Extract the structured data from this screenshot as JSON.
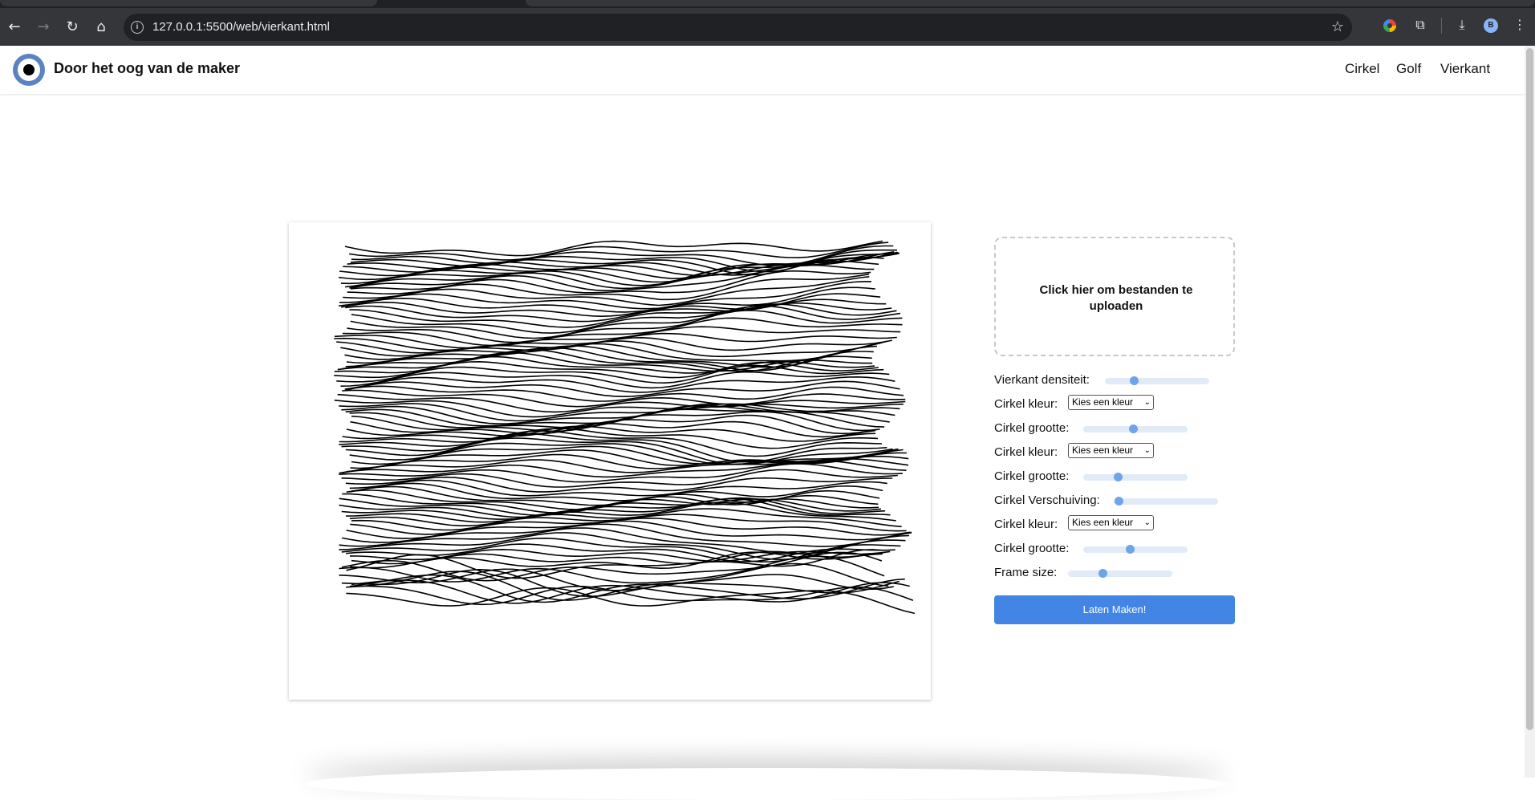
{
  "browser": {
    "url": "127.0.0.1:5500/web/vierkant.html",
    "avatar_letter": "B"
  },
  "site": {
    "title": "Door het oog van de maker",
    "nav": [
      "Cirkel",
      "Golf",
      "Vierkant"
    ]
  },
  "upload": {
    "label": "Click hier om bestanden te uploaden"
  },
  "controls": [
    {
      "label": "Vierkant densiteit:",
      "type": "slider",
      "value": 0.28
    },
    {
      "label": "Cirkel kleur:",
      "type": "select",
      "value": "Kies een kleur"
    },
    {
      "label": "Cirkel grootte:",
      "type": "slider",
      "value": 0.48
    },
    {
      "label": "Cirkel kleur:",
      "type": "select",
      "value": "Kies een kleur"
    },
    {
      "label": "Cirkel grootte:",
      "type": "slider",
      "value": 0.33
    },
    {
      "label": "Cirkel Verschuiving:",
      "type": "slider",
      "value": 0.03
    },
    {
      "label": "Cirkel kleur:",
      "type": "select",
      "value": "Kies een kleur"
    },
    {
      "label": "Cirkel grootte:",
      "type": "slider",
      "value": 0.45
    },
    {
      "label": "Frame size:",
      "type": "slider",
      "value": 0.33
    }
  ],
  "make_button": "Laten Maken!",
  "colors": {
    "accent": "#4285e4",
    "logo_ring": "#5b83c2",
    "slider_thumb": "#6fa3ea"
  }
}
